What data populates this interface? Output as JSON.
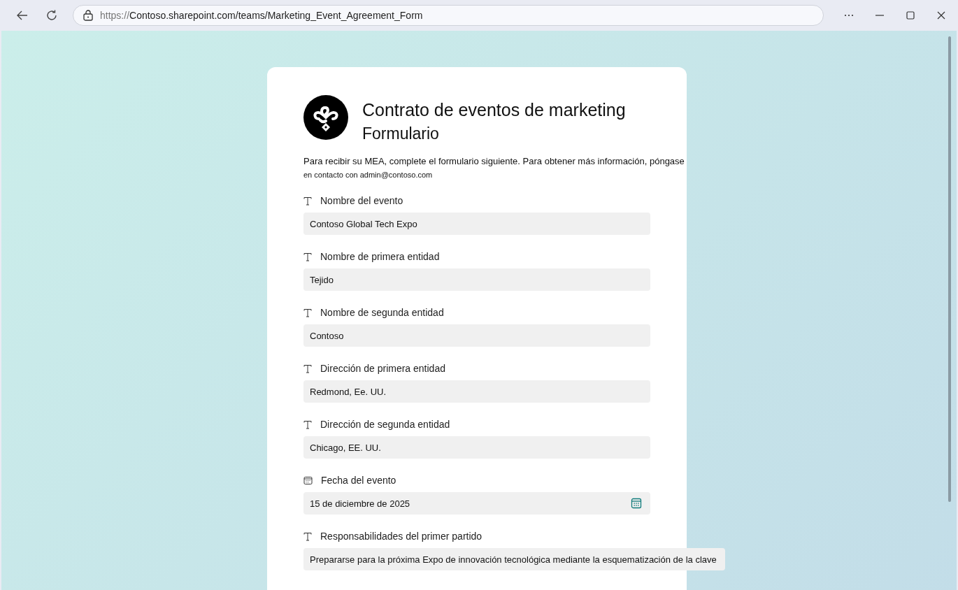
{
  "browser": {
    "url_scheme": "https://",
    "url_rest": "Contoso.sharepoint.com/teams/Marketing_Event_Agreement_Form"
  },
  "form": {
    "title": "Contrato de eventos de marketing",
    "subtitle": "Formulario",
    "intro_line_1": "Para recibir su MEA, complete el formulario siguiente. Para obtener más información, póngase",
    "intro_line_2": "en contacto con admin@contoso.com",
    "fields": [
      {
        "kind": "text",
        "label": "Nombre del evento",
        "value": "Contoso Global Tech Expo"
      },
      {
        "kind": "text",
        "label": "Nombre de primera entidad",
        "value": "Tejido"
      },
      {
        "kind": "text",
        "label": "Nombre de segunda entidad",
        "value": "Contoso"
      },
      {
        "kind": "text",
        "label": "Dirección de primera entidad",
        "value": "Redmond, Ee. UU."
      },
      {
        "kind": "text",
        "label": "Dirección de segunda entidad",
        "value": "Chicago, EE. UU."
      },
      {
        "kind": "date",
        "label": "Fecha del evento",
        "value": "15 de diciembre de 2025"
      },
      {
        "kind": "text",
        "label": "Responsabilidades del primer partido",
        "value": "Prepararse para la próxima Expo de innovación tecnológica mediante la esquematización de la clave"
      }
    ]
  }
}
